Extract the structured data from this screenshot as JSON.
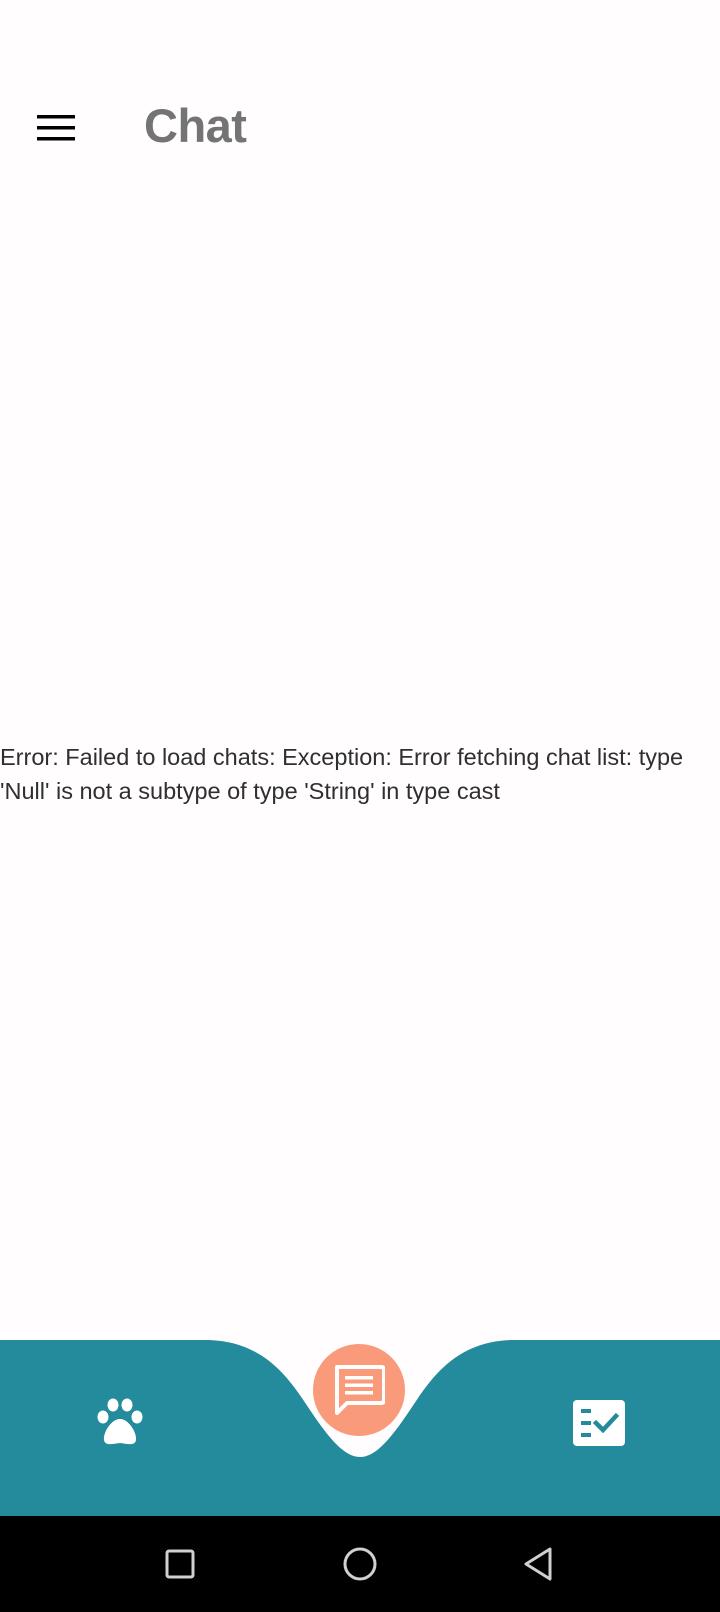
{
  "header": {
    "title": "Chat",
    "menu_icon": "hamburger-menu-icon"
  },
  "main": {
    "error_message": "Error: Failed to load chats: Exception: Error fetching chat list: type 'Null' is not a subtype of type 'String' in type cast"
  },
  "bottom_nav": {
    "items": [
      {
        "icon": "paw-icon"
      },
      {
        "icon": "chat-icon",
        "active": true
      },
      {
        "icon": "task-checklist-icon"
      }
    ]
  },
  "system_nav": {
    "buttons": [
      {
        "icon": "recent-apps-icon"
      },
      {
        "icon": "home-icon"
      },
      {
        "icon": "back-icon"
      }
    ]
  },
  "colors": {
    "background": "#fffdfd",
    "title": "#747474",
    "nav_bar": "#238b9c",
    "fab": "#f99a7b",
    "system_nav": "#000000"
  }
}
